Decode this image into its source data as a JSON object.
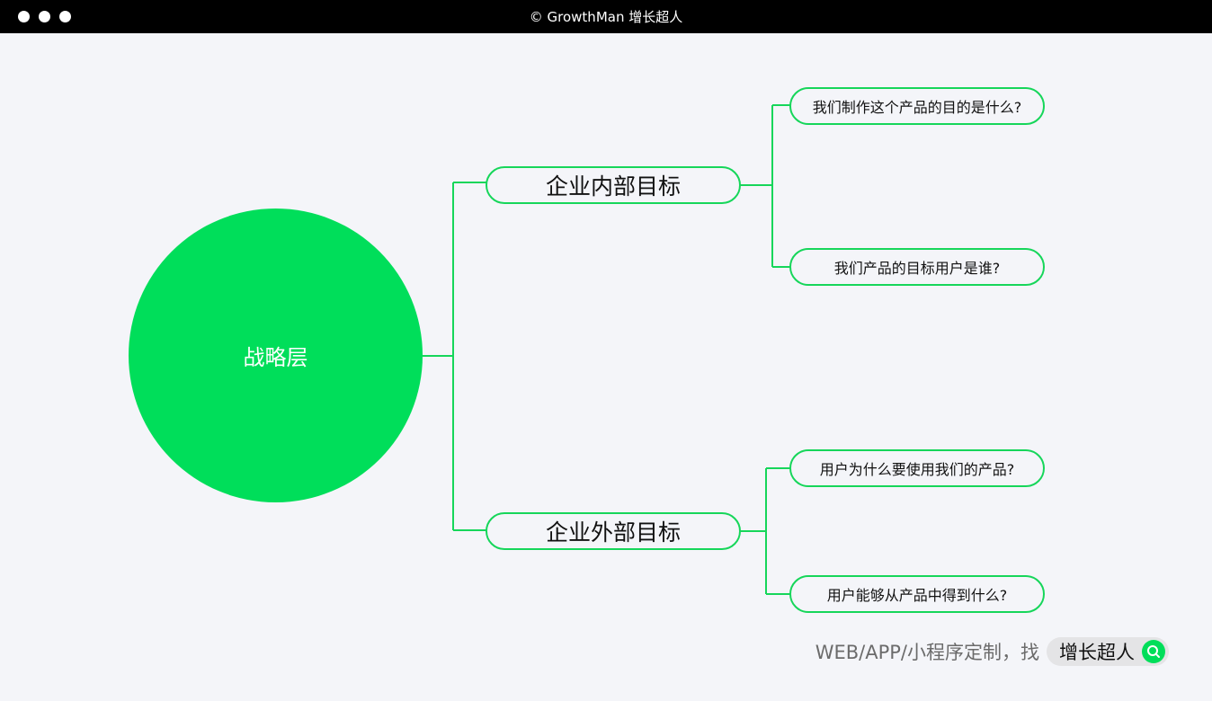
{
  "window": {
    "title": "© GrowthMan 增长超人",
    "controls": [
      "dot",
      "dot",
      "dot"
    ]
  },
  "mindmap": {
    "root": "战略层",
    "branches": [
      {
        "label": "企业内部目标",
        "children": [
          "我们制作这个产品的目的是什么?",
          "我们产品的目标用户是谁?"
        ]
      },
      {
        "label": "企业外部目标",
        "children": [
          "用户为什么要使用我们的产品?",
          "用户能够从产品中得到什么?"
        ]
      }
    ]
  },
  "footer": {
    "text": "WEB/APP/小程序定制，找",
    "brand": "增长超人",
    "icon": "search-icon"
  },
  "colors": {
    "accent": "#00de5a",
    "line": "#16d65a",
    "background": "#f4f5f9",
    "titlebar": "#000000"
  }
}
